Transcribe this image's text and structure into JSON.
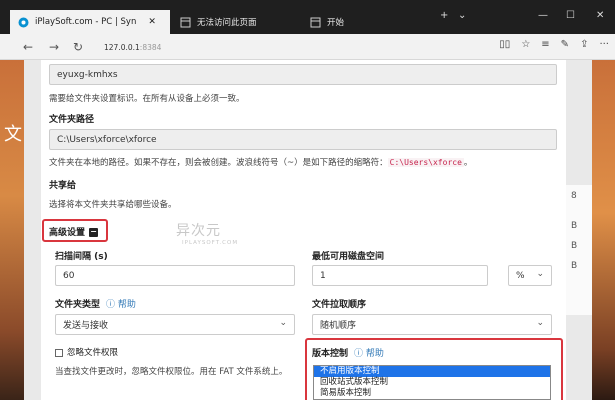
{
  "browser": {
    "tabs": [
      {
        "title": "iPlaySoft.com - PC | Syn",
        "active": true
      },
      {
        "title": "无法访问此页面",
        "active": false
      },
      {
        "title": "开始",
        "active": false
      }
    ],
    "url_host": "127.0.0.1",
    "url_port": ":8384"
  },
  "background": {
    "left_char": "文",
    "right_chars": [
      "8",
      "B",
      "B",
      "B"
    ]
  },
  "form": {
    "folder_id_value": "eyuxg-kmhxs",
    "folder_id_help": "需要给文件夹设置标识。在所有从设备上必须一致。",
    "folder_path_label": "文件夹路径",
    "folder_path_value": "C:\\Users\\xforce\\xforce",
    "folder_path_help": "文件夹在本地的路径。如果不存在，则会被创建。波浪线符号（~）是如下路径的缩略符：",
    "folder_path_code": "C:\\Users\\xforce",
    "folder_path_help_end": "。",
    "share_label": "共享给",
    "share_help": "选择将本文件夹共享给哪些设备。",
    "advanced_label": "高级设置",
    "scan_interval_label": "扫描间隔 (s)",
    "scan_interval_value": "60",
    "min_disk_label": "最低可用磁盘空间",
    "min_disk_value": "1",
    "min_disk_unit": "%",
    "folder_type_label": "文件夹类型",
    "folder_type_help_link": "帮助",
    "folder_type_value": "发送与接收",
    "pull_order_label": "文件拉取顺序",
    "pull_order_value": "随机顺序",
    "ignore_perms_label": "忽略文件权限",
    "ignore_perms_help": "当查找文件更改时，忽略文件权限位。用在 FAT 文件系统上。",
    "versioning_label": "版本控制",
    "versioning_help_link": "帮助",
    "versioning_options": [
      "不启用版本控制",
      "回收站式版本控制",
      "简易版本控制"
    ]
  },
  "watermark": {
    "main": "异次元",
    "sub": "IPLAYSOFT.COM"
  },
  "colors": {
    "highlight_red": "#d9363e",
    "link_blue": "#337ab7",
    "selected_option": "#1e73e8"
  }
}
